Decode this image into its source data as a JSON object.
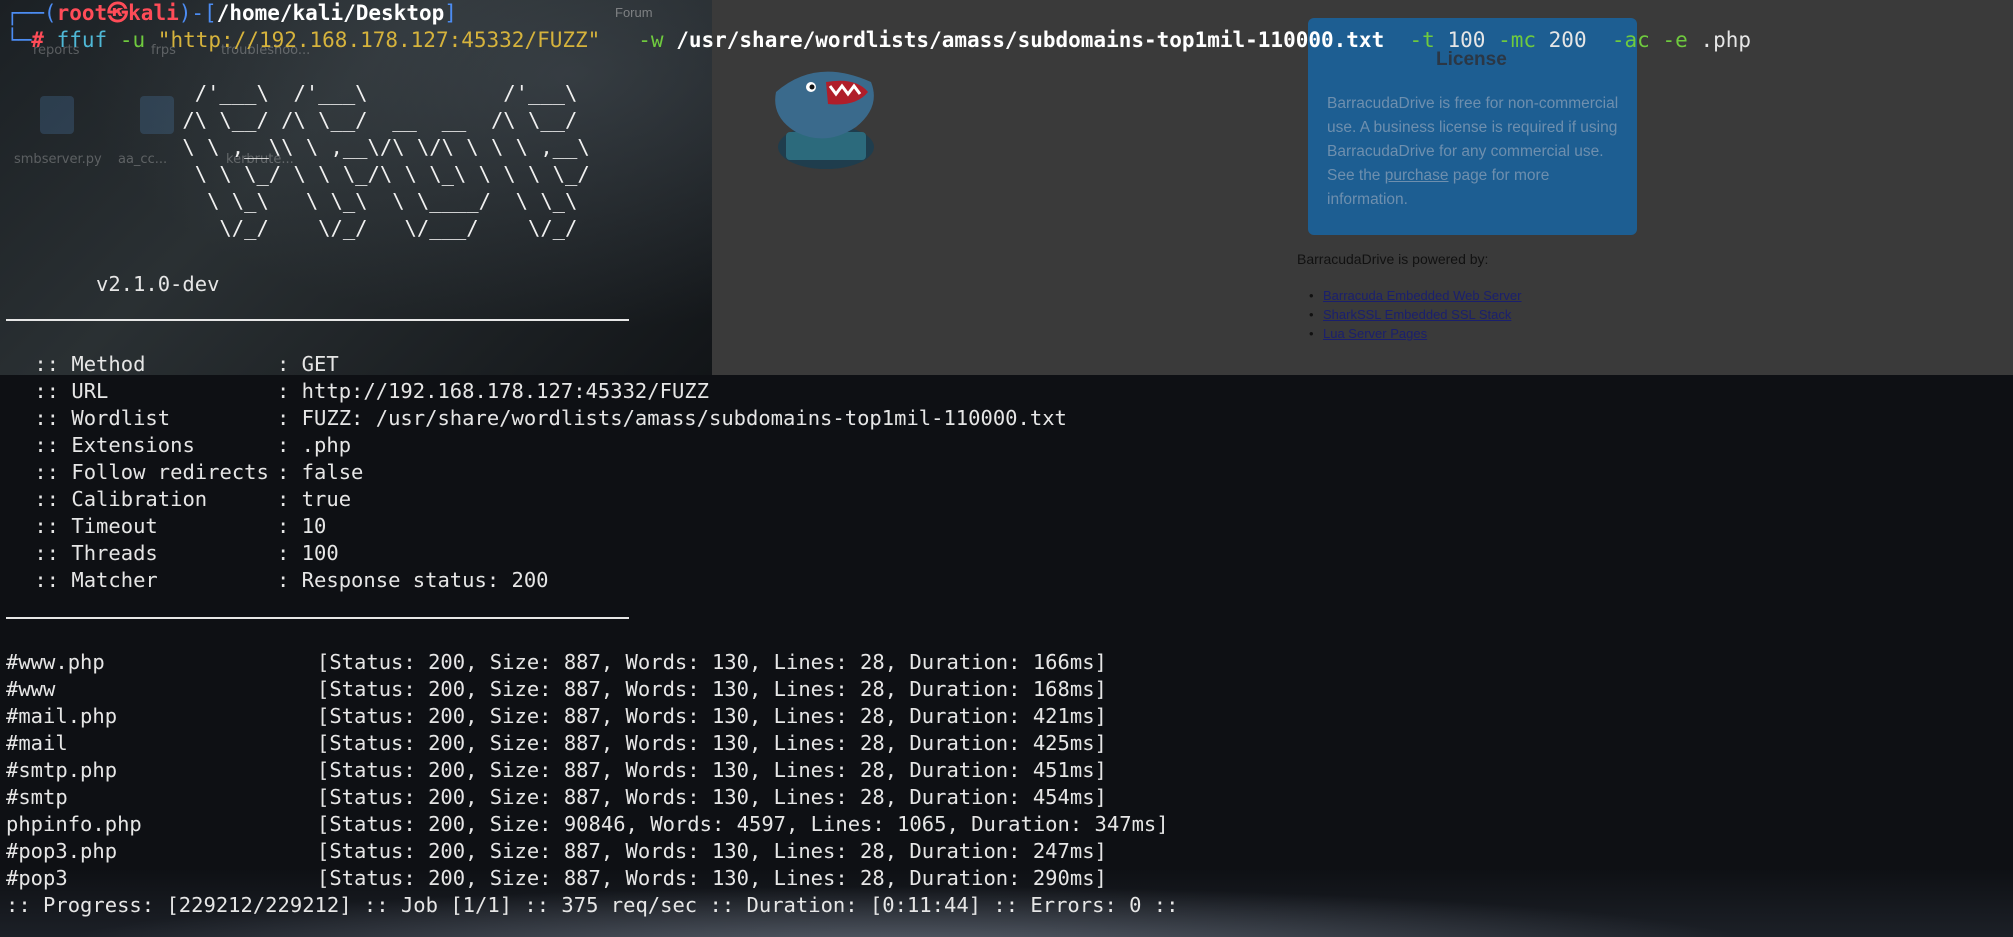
{
  "background": {
    "desktop_icons": [
      {
        "label": "reports"
      },
      {
        "label": "frps"
      },
      {
        "label": "troubleshoo..."
      },
      {
        "label": "smbserver.py"
      },
      {
        "label": "aa_cc..."
      },
      {
        "label": "kerbrute..."
      }
    ],
    "browser": {
      "tab_label": "Forum",
      "license": {
        "title": "License",
        "text_before": "BarracudaDrive is free for non-commercial use. A business license is required if using BarracudaDrive for any commercial use. See the ",
        "link": "purchase",
        "text_after": " page for more information."
      },
      "powered_by": "BarracudaDrive is powered by:",
      "links": [
        "Barracuda Embedded Web Server",
        "SharkSSL Embedded SSL Stack",
        "Lua Server Pages"
      ]
    }
  },
  "terminal": {
    "prompt": {
      "user": "root",
      "host": "kali",
      "path": "/home/kali/Desktop",
      "symbol": "#"
    },
    "command": {
      "program": "ffuf",
      "u_flag": "-u",
      "url": "\"http://192.168.178.127:45332/FUZZ\"",
      "w_flag": "-w",
      "wordlist": "/usr/share/wordlists/amass/subdomains-top1mil-110000.txt",
      "t_flag": "-t",
      "threads": "100",
      "mc_flag": "-mc",
      "match_code": "200",
      "ac_flag": "-ac",
      "e_flag": "-e",
      "extension": ".php"
    },
    "banner_ascii": "        /'___\\  /'___\\           /'___\\       \n       /\\ \\__/ /\\ \\__/  __  __  /\\ \\__/       \n       \\ \\ ,__\\\\ \\ ,__\\/\\ \\/\\ \\ \\ \\ ,__\\      \n        \\ \\ \\_/ \\ \\ \\_/\\ \\ \\_\\ \\ \\ \\ \\_/      \n         \\ \\_\\   \\ \\_\\  \\ \\____/  \\ \\_\\       \n          \\/_/    \\/_/   \\/___/    \\/_/       ",
    "version": "v2.1.0-dev",
    "config": [
      {
        "key": " :: Method",
        "value": ": GET"
      },
      {
        "key": " :: URL",
        "value": ": http://192.168.178.127:45332/FUZZ"
      },
      {
        "key": " :: Wordlist",
        "value": ": FUZZ: /usr/share/wordlists/amass/subdomains-top1mil-110000.txt"
      },
      {
        "key": " :: Extensions",
        "value": ": .php"
      },
      {
        "key": " :: Follow redirects",
        "value": ": false"
      },
      {
        "key": " :: Calibration",
        "value": ": true"
      },
      {
        "key": " :: Timeout",
        "value": ": 10"
      },
      {
        "key": " :: Threads",
        "value": ": 100"
      },
      {
        "key": " :: Matcher",
        "value": ": Response status: 200"
      }
    ],
    "results": [
      {
        "name": "#www.php",
        "status": "[Status: 200, Size: 887, Words: 130, Lines: 28, Duration: 166ms]"
      },
      {
        "name": "#www",
        "status": "[Status: 200, Size: 887, Words: 130, Lines: 28, Duration: 168ms]"
      },
      {
        "name": "#mail.php",
        "status": "[Status: 200, Size: 887, Words: 130, Lines: 28, Duration: 421ms]"
      },
      {
        "name": "#mail",
        "status": "[Status: 200, Size: 887, Words: 130, Lines: 28, Duration: 425ms]"
      },
      {
        "name": "#smtp.php",
        "status": "[Status: 200, Size: 887, Words: 130, Lines: 28, Duration: 451ms]"
      },
      {
        "name": "#smtp",
        "status": "[Status: 200, Size: 887, Words: 130, Lines: 28, Duration: 454ms]"
      },
      {
        "name": "phpinfo.php",
        "status": "[Status: 200, Size: 90846, Words: 4597, Lines: 1065, Duration: 347ms]"
      },
      {
        "name": "#pop3.php",
        "status": "[Status: 200, Size: 887, Words: 130, Lines: 28, Duration: 247ms]"
      },
      {
        "name": "#pop3",
        "status": "[Status: 200, Size: 887, Words: 130, Lines: 28, Duration: 290ms]"
      }
    ],
    "progress": ":: Progress: [229212/229212] :: Job [1/1] :: 375 req/sec :: Duration: [0:11:44] :: Errors: 0 ::"
  },
  "colors": {
    "prompt_frame": "#4c8cf2",
    "prompt_user": "#ff4c58",
    "flag": "#6fca3e",
    "url_string": "#d6b33c",
    "license_box": "#1d5e92"
  }
}
